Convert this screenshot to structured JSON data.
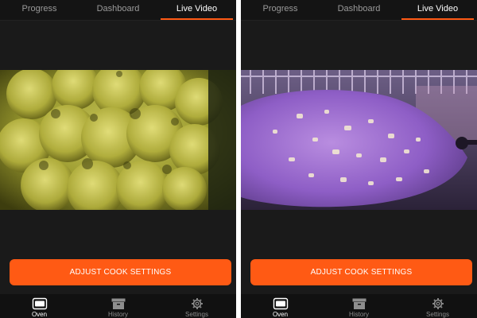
{
  "screens": [
    {
      "tabs": [
        {
          "label": "Progress",
          "active": false
        },
        {
          "label": "Dashboard",
          "active": false
        },
        {
          "label": "Live Video",
          "active": true
        }
      ],
      "video": {
        "subject": "cauliflower-feed"
      },
      "cta_label": "ADJUST COOK SETTINGS",
      "nav": [
        {
          "label": "Oven",
          "icon": "oven-icon",
          "active": true
        },
        {
          "label": "History",
          "icon": "archive-box-icon",
          "active": false
        },
        {
          "label": "Settings",
          "icon": "gear-icon",
          "active": false
        }
      ]
    },
    {
      "tabs": [
        {
          "label": "Progress",
          "active": false
        },
        {
          "label": "Dashboard",
          "active": false
        },
        {
          "label": "Live Video",
          "active": true
        }
      ],
      "video": {
        "subject": "purple-dish-feed"
      },
      "cta_label": "ADJUST COOK SETTINGS",
      "nav": [
        {
          "label": "Oven",
          "icon": "oven-icon",
          "active": true
        },
        {
          "label": "History",
          "icon": "archive-box-icon",
          "active": false
        },
        {
          "label": "Settings",
          "icon": "gear-icon",
          "active": false
        }
      ]
    }
  ],
  "colors": {
    "accent": "#ff5a14",
    "background": "#1a1a1a",
    "tab_bar": "#141414",
    "nav_bar": "#111111",
    "inactive_text": "#9a9a9a"
  }
}
